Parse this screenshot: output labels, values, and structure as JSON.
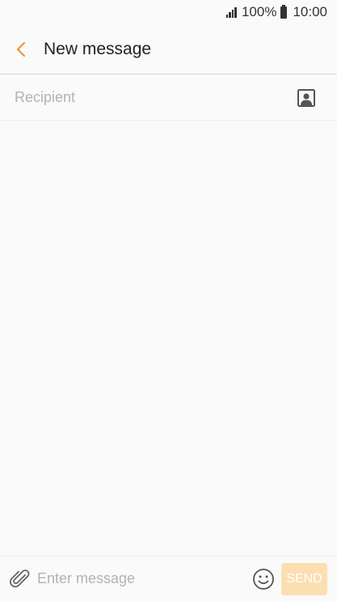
{
  "status_bar": {
    "battery": "100%",
    "time": "10:00",
    "icons": [
      "signal-icon",
      "battery-icon"
    ]
  },
  "header": {
    "title": "New message",
    "back_icon": "chevron-left-icon"
  },
  "recipient": {
    "placeholder": "Recipient",
    "value": "",
    "contacts_icon": "contact-card-icon"
  },
  "compose": {
    "placeholder": "Enter message",
    "value": "",
    "attach_icon": "paperclip-icon",
    "emoji_icon": "smiley-icon",
    "send_label": "SEND"
  },
  "colors": {
    "accent": "#e8923c",
    "send_button": "#fbdfaf",
    "background": "#fafafa"
  }
}
